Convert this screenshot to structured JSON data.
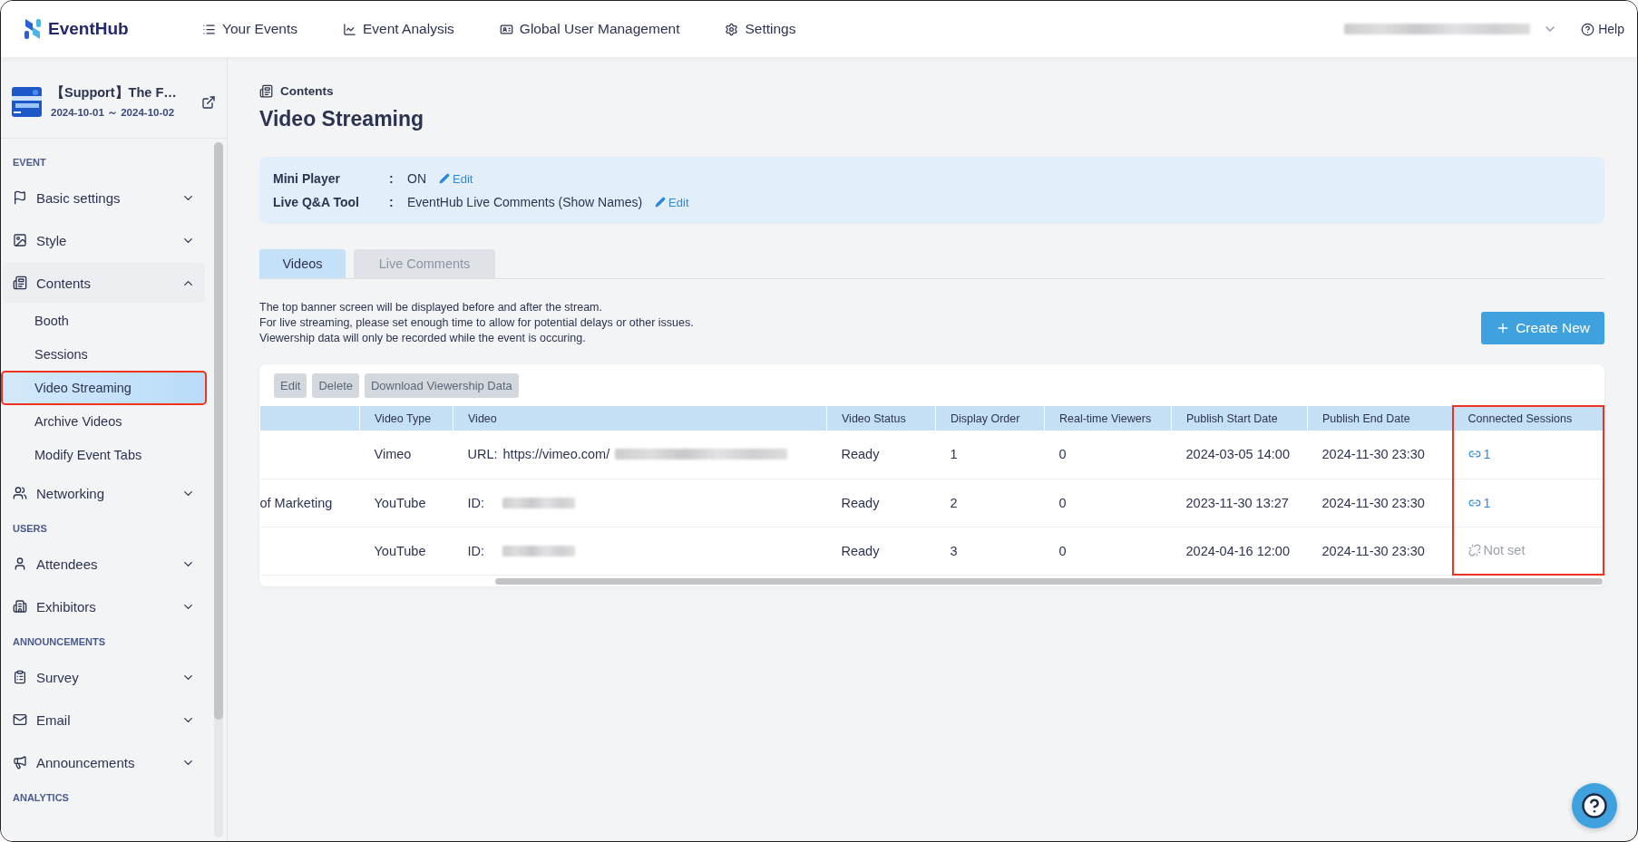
{
  "header": {
    "logo": "EventHub",
    "nav": [
      {
        "label": "Your Events"
      },
      {
        "label": "Event Analysis"
      },
      {
        "label": "Global User Management"
      },
      {
        "label": "Settings"
      }
    ],
    "help": "Help"
  },
  "event": {
    "title": "【Support】The F…",
    "dates": "2024-10-01 ～ 2024-10-02"
  },
  "sidebar": {
    "sections": [
      {
        "heading": "EVENT",
        "items": [
          {
            "label": "Basic settings",
            "expanded": false
          },
          {
            "label": "Style",
            "expanded": false
          },
          {
            "label": "Contents",
            "expanded": true,
            "children": [
              {
                "label": "Booth",
                "selected": false,
                "highlighted": false
              },
              {
                "label": "Sessions",
                "selected": false,
                "highlighted": false
              },
              {
                "label": "Video Streaming",
                "selected": true,
                "highlighted": true
              },
              {
                "label": "Archive Videos",
                "selected": false,
                "highlighted": false
              },
              {
                "label": "Modify Event Tabs",
                "selected": false,
                "highlighted": false
              }
            ]
          },
          {
            "label": "Networking",
            "expanded": false
          }
        ]
      },
      {
        "heading": "USERS",
        "items": [
          {
            "label": "Attendees",
            "expanded": false
          },
          {
            "label": "Exhibitors",
            "expanded": false
          }
        ]
      },
      {
        "heading": "ANNOUNCEMENTS",
        "items": [
          {
            "label": "Survey",
            "expanded": false
          },
          {
            "label": "Email",
            "expanded": false
          },
          {
            "label": "Announcements",
            "expanded": false
          }
        ]
      },
      {
        "heading": "ANALYTICS"
      }
    ]
  },
  "page": {
    "breadcrumb": "Contents",
    "title": "Video Streaming"
  },
  "settings": [
    {
      "label": "Mini Player",
      "separator": ":",
      "value": "ON",
      "action": "Edit"
    },
    {
      "label": "Live Q&A Tool",
      "separator": ":",
      "value": "EventHub Live Comments (Show Names)",
      "action": "Edit"
    }
  ],
  "tabs": [
    {
      "label": "Videos",
      "selected": true
    },
    {
      "label": "Live Comments",
      "selected": false
    }
  ],
  "notes": [
    "The top banner screen will be displayed before and after the stream.",
    "For live streaming, please set enough time to allow for potential delays or other issues.",
    "Viewership data will only be recorded while the event is occuring."
  ],
  "create_button": "Create New",
  "table": {
    "actions": [
      {
        "label": "Edit",
        "disabled": true
      },
      {
        "label": "Delete",
        "disabled": true
      },
      {
        "label": "Download Viewership Data",
        "disabled": true
      }
    ],
    "columns": [
      {
        "highlighted": false
      },
      {
        "label": "Video Type",
        "highlighted": false
      },
      {
        "label": "Video",
        "highlighted": false
      },
      {
        "label": "Video Status",
        "highlighted": false
      },
      {
        "label": "Display Order",
        "highlighted": false
      },
      {
        "label": "Real-time Viewers",
        "highlighted": false
      },
      {
        "label": "Publish Start Date",
        "highlighted": false
      },
      {
        "label": "Publish End Date",
        "highlighted": false
      },
      {
        "label": "Connected Sessions",
        "highlighted": true
      }
    ],
    "rows": [
      {
        "column_1": null,
        "type": "Vimeo",
        "video_prefix": "URL:",
        "video": "https://vimeo.com/",
        "status": "Ready",
        "order": "1",
        "viewers": "0",
        "start": "2024-03-05 14:00",
        "end": "2024-11-30 23:30",
        "sessions": {
          "connected": true,
          "text": "1"
        }
      },
      {
        "column_1": "of Marketing",
        "type": "YouTube",
        "video_prefix": "ID:",
        "video": null,
        "status": "Ready",
        "order": "2",
        "viewers": "0",
        "start": "2023-11-30 13:27",
        "end": "2024-11-30 23:30",
        "sessions": {
          "connected": true,
          "text": "1"
        }
      },
      {
        "column_1": null,
        "type": "YouTube",
        "video_prefix": "ID:",
        "video": null,
        "status": "Ready",
        "order": "3",
        "viewers": "0",
        "start": "2024-04-16 12:00",
        "end": "2024-11-30 23:30",
        "sessions": {
          "connected": false,
          "text": "Not set"
        }
      }
    ]
  }
}
